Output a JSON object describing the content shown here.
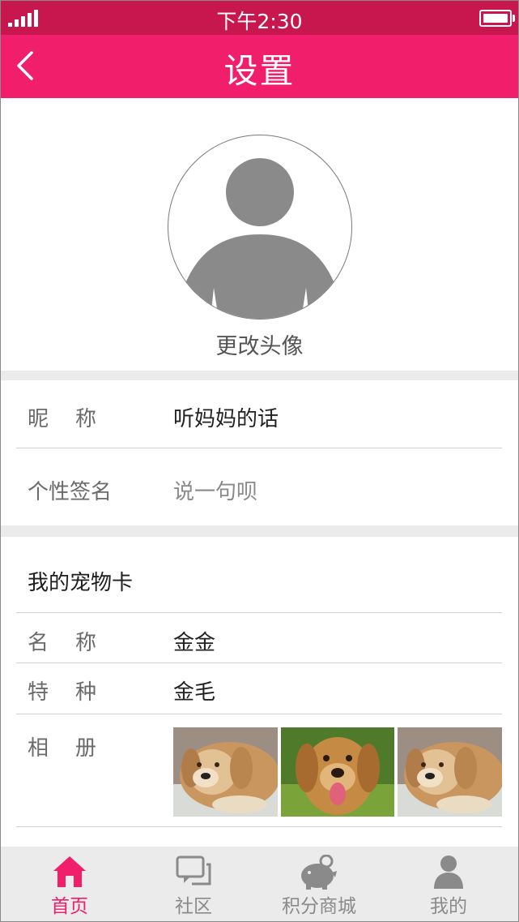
{
  "status_bar": {
    "time": "下午2:30"
  },
  "header": {
    "title": "设置",
    "back_icon": "chevron-left-icon"
  },
  "avatar": {
    "change_label": "更改头像",
    "icon": "user-avatar-placeholder"
  },
  "profile": {
    "nickname": {
      "label": "昵    称",
      "value": "听妈妈的话"
    },
    "signature": {
      "label": "个性签名",
      "placeholder": "说一句呗"
    }
  },
  "pet_card": {
    "title": "我的宠物卡",
    "name": {
      "label": "名    称",
      "value": "金金"
    },
    "breed": {
      "label": "特    种",
      "value": "金毛"
    },
    "album": {
      "label": "相    册",
      "photos": [
        "golden-retriever-lying",
        "golden-retriever-tongue-out",
        "golden-retriever-lying"
      ]
    }
  },
  "tabs": [
    {
      "label": "首页",
      "icon": "home-icon",
      "active": true
    },
    {
      "label": "社区",
      "icon": "chat-icon",
      "active": false
    },
    {
      "label": "积分商城",
      "icon": "piggy-bank-icon",
      "active": false
    },
    {
      "label": "我的",
      "icon": "person-icon",
      "active": false
    }
  ],
  "colors": {
    "primary": "#f01e6b",
    "status_bar": "#c8174f",
    "band": "#ebebeb",
    "tab_inactive": "#8a8a8a"
  }
}
